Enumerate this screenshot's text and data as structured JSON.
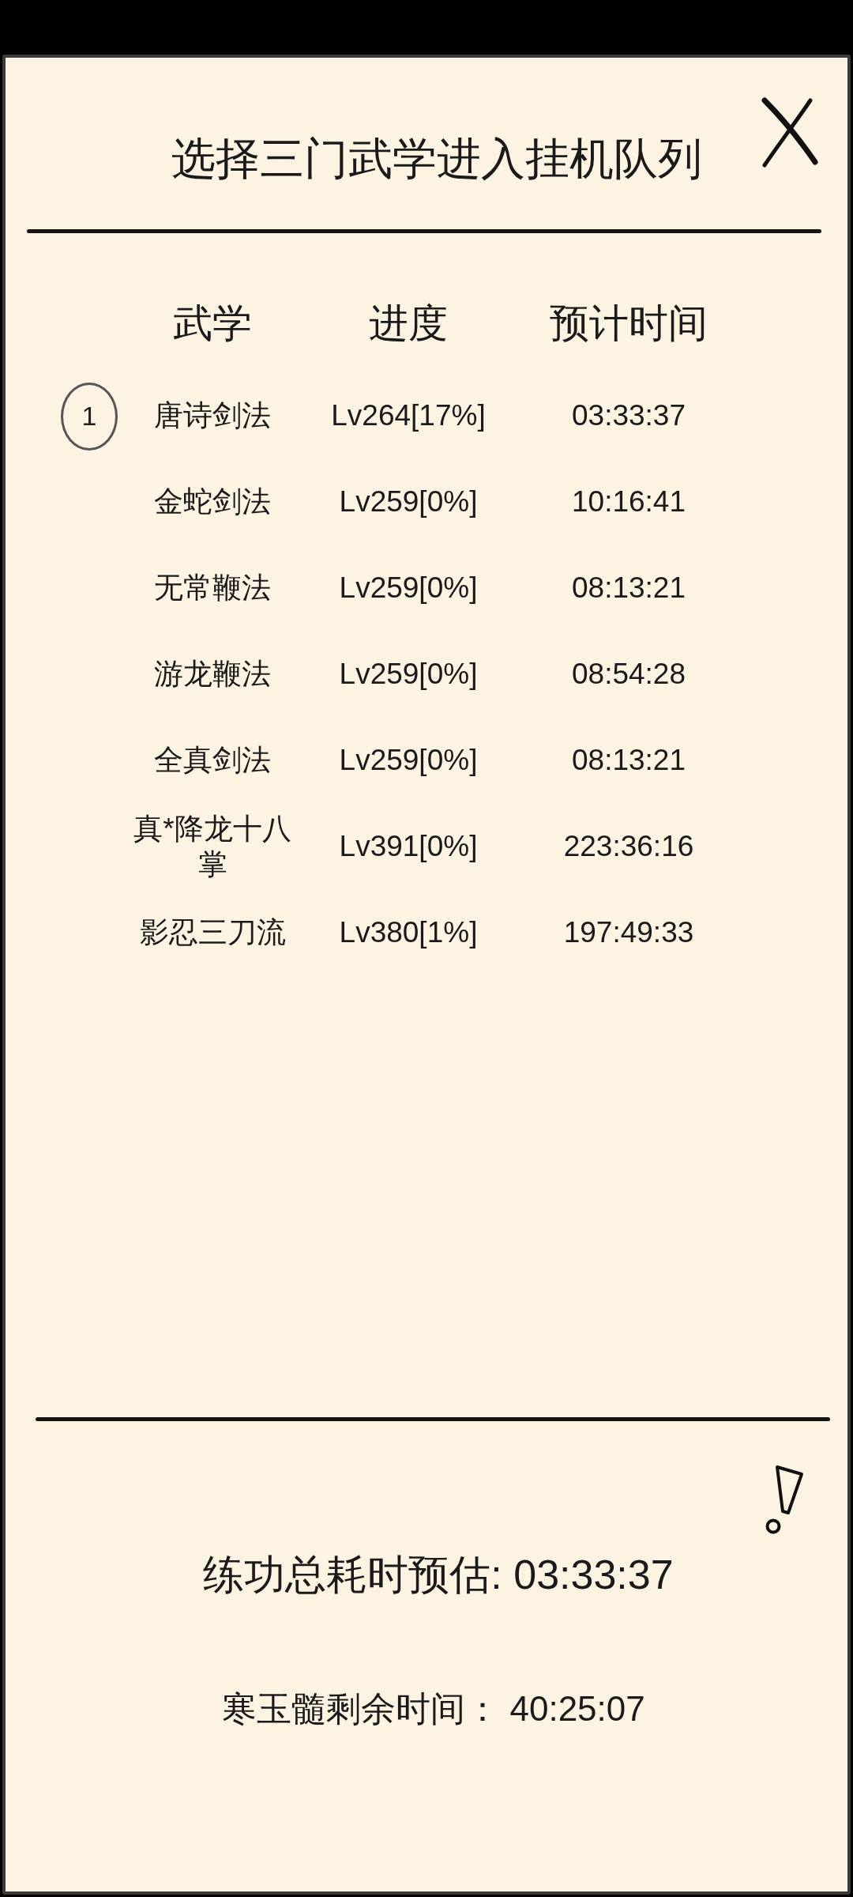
{
  "title": "选择三门武学进入挂机队列",
  "table": {
    "columns": [
      "武学",
      "进度",
      "预计时间"
    ],
    "rows": [
      {
        "name": "唐诗剑法",
        "progress": "Lv264[17%]",
        "time": "03:33:37",
        "selected": true,
        "queue_number": "1"
      },
      {
        "name": "金蛇剑法",
        "progress": "Lv259[0%]",
        "time": "10:16:41",
        "selected": false
      },
      {
        "name": "无常鞭法",
        "progress": "Lv259[0%]",
        "time": "08:13:21",
        "selected": false
      },
      {
        "name": "游龙鞭法",
        "progress": "Lv259[0%]",
        "time": "08:54:28",
        "selected": false
      },
      {
        "name": "全真剑法",
        "progress": "Lv259[0%]",
        "time": "08:13:21",
        "selected": false
      },
      {
        "name": "真*降龙十八掌",
        "progress": "Lv391[0%]",
        "time": "223:36:16",
        "selected": false
      },
      {
        "name": "影忍三刀流",
        "progress": "Lv380[1%]",
        "time": "197:49:33",
        "selected": false
      }
    ]
  },
  "summary": {
    "total_time": "练功总耗时预估: 03:33:37",
    "remaining_time": "寒玉髓剩余时间： 40:25:07"
  }
}
